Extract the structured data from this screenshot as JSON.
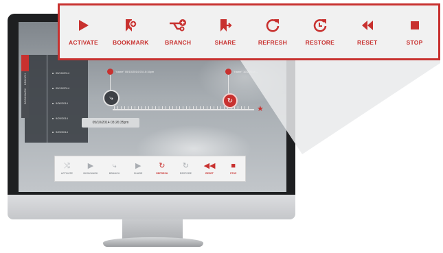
{
  "toolbar": {
    "items": [
      {
        "label": "ACTIVATE",
        "icon": "play-icon"
      },
      {
        "label": "BOOKMARK",
        "icon": "bookmark-add-icon"
      },
      {
        "label": "BRANCH",
        "icon": "branch-icon"
      },
      {
        "label": "SHARE",
        "icon": "bookmark-share-icon"
      },
      {
        "label": "REFRESH",
        "icon": "refresh-icon"
      },
      {
        "label": "RESTORE",
        "icon": "restore-clock-icon"
      },
      {
        "label": "RESET",
        "icon": "rewind-icon"
      },
      {
        "label": "STOP",
        "icon": "stop-icon"
      }
    ]
  },
  "small_toolbar": {
    "items": [
      {
        "label": "ACTIVATE",
        "state": "disabled"
      },
      {
        "label": "BOOKMARK",
        "state": "disabled"
      },
      {
        "label": "BRANCH",
        "state": "disabled"
      },
      {
        "label": "SHARE",
        "state": "disabled"
      },
      {
        "label": "REFRESH",
        "state": "enabled"
      },
      {
        "label": "RESTORE",
        "state": "disabled"
      },
      {
        "label": "RESET",
        "state": "enabled"
      },
      {
        "label": "STOP",
        "state": "enabled"
      }
    ]
  },
  "timeline": {
    "tooltip": "05/10/2014 03:26:35pm",
    "pin_left_label": "\"name\" 05/10/2014 03:15:15pm",
    "pin_right_label": "\"name\" 10/2/2014 ...",
    "list": [
      "05/10/2014",
      "05/10/2014",
      "9/30/2014",
      "9/29/2014",
      "9/29/2014"
    ]
  },
  "side_tabs": [
    "",
    "BRANCH",
    "BOOKMARK"
  ],
  "colors": {
    "accent": "#c8312f",
    "toolbar_bg": "#f1f1f1"
  }
}
